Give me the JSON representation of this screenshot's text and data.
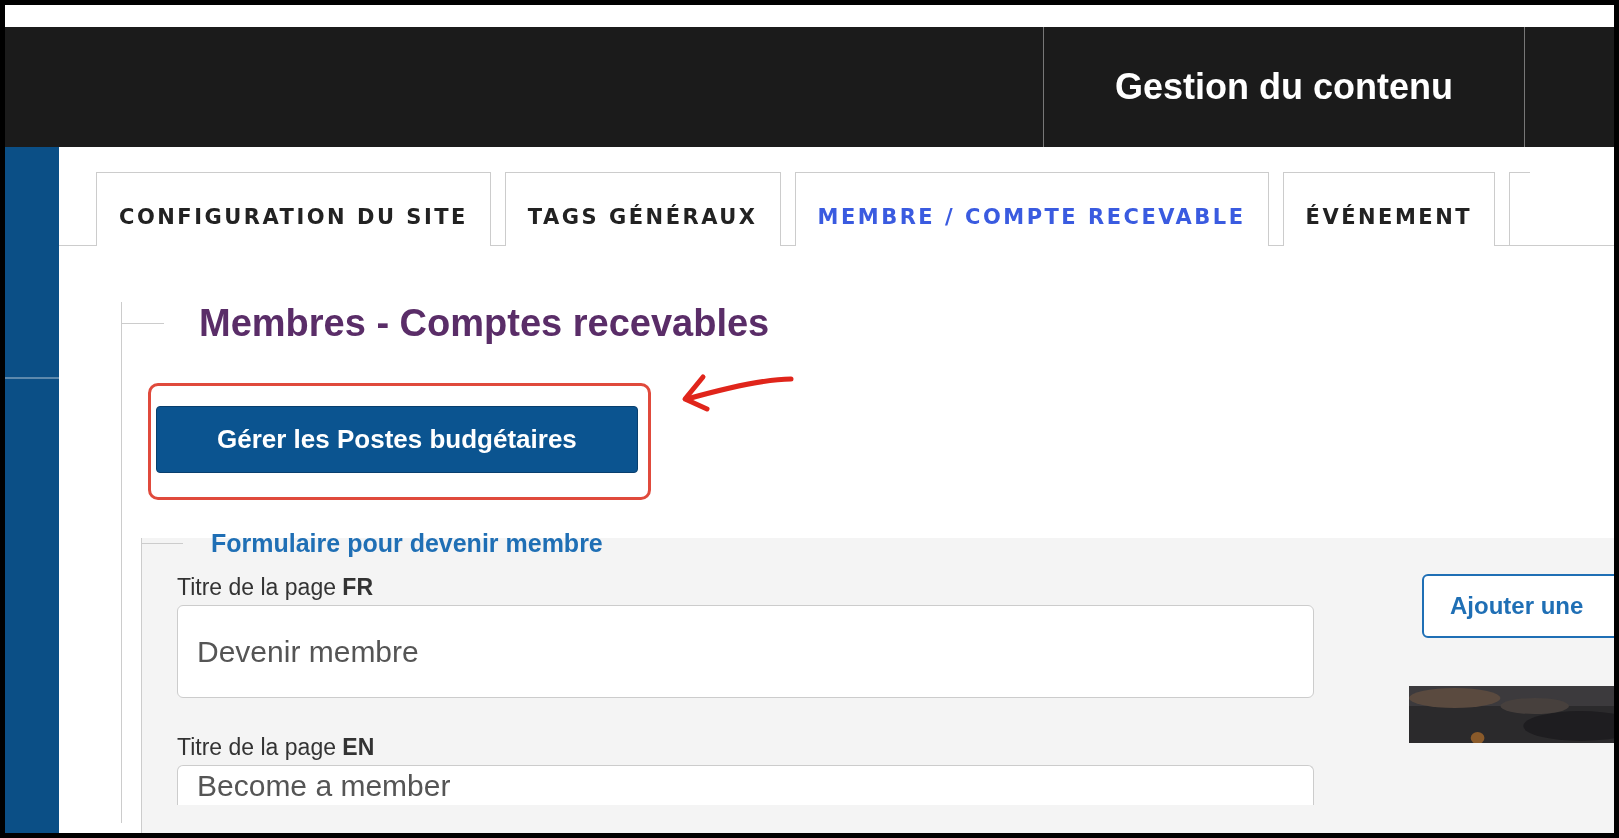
{
  "top_bar": {
    "title": "Gestion du contenu"
  },
  "tabs": [
    {
      "label": "CONFIGURATION DU SITE",
      "selected": false
    },
    {
      "label": "TAGS GÉNÉRAUX",
      "selected": false
    },
    {
      "label": "MEMBRE / COMPTE RECEVABLE",
      "selected": true
    },
    {
      "label": "ÉVÉNEMENT",
      "selected": false
    }
  ],
  "section": {
    "title": "Membres - Comptes recevables",
    "button": "Gérer les Postes budgétaires"
  },
  "form": {
    "legend": "Formulaire pour devenir membre",
    "fields": [
      {
        "label": "Titre de la page **FR**",
        "value": "Devenir membre"
      },
      {
        "label": "Titre de la page **EN**",
        "value": "Become a member"
      }
    ],
    "side_button": "Ajouter une"
  }
}
